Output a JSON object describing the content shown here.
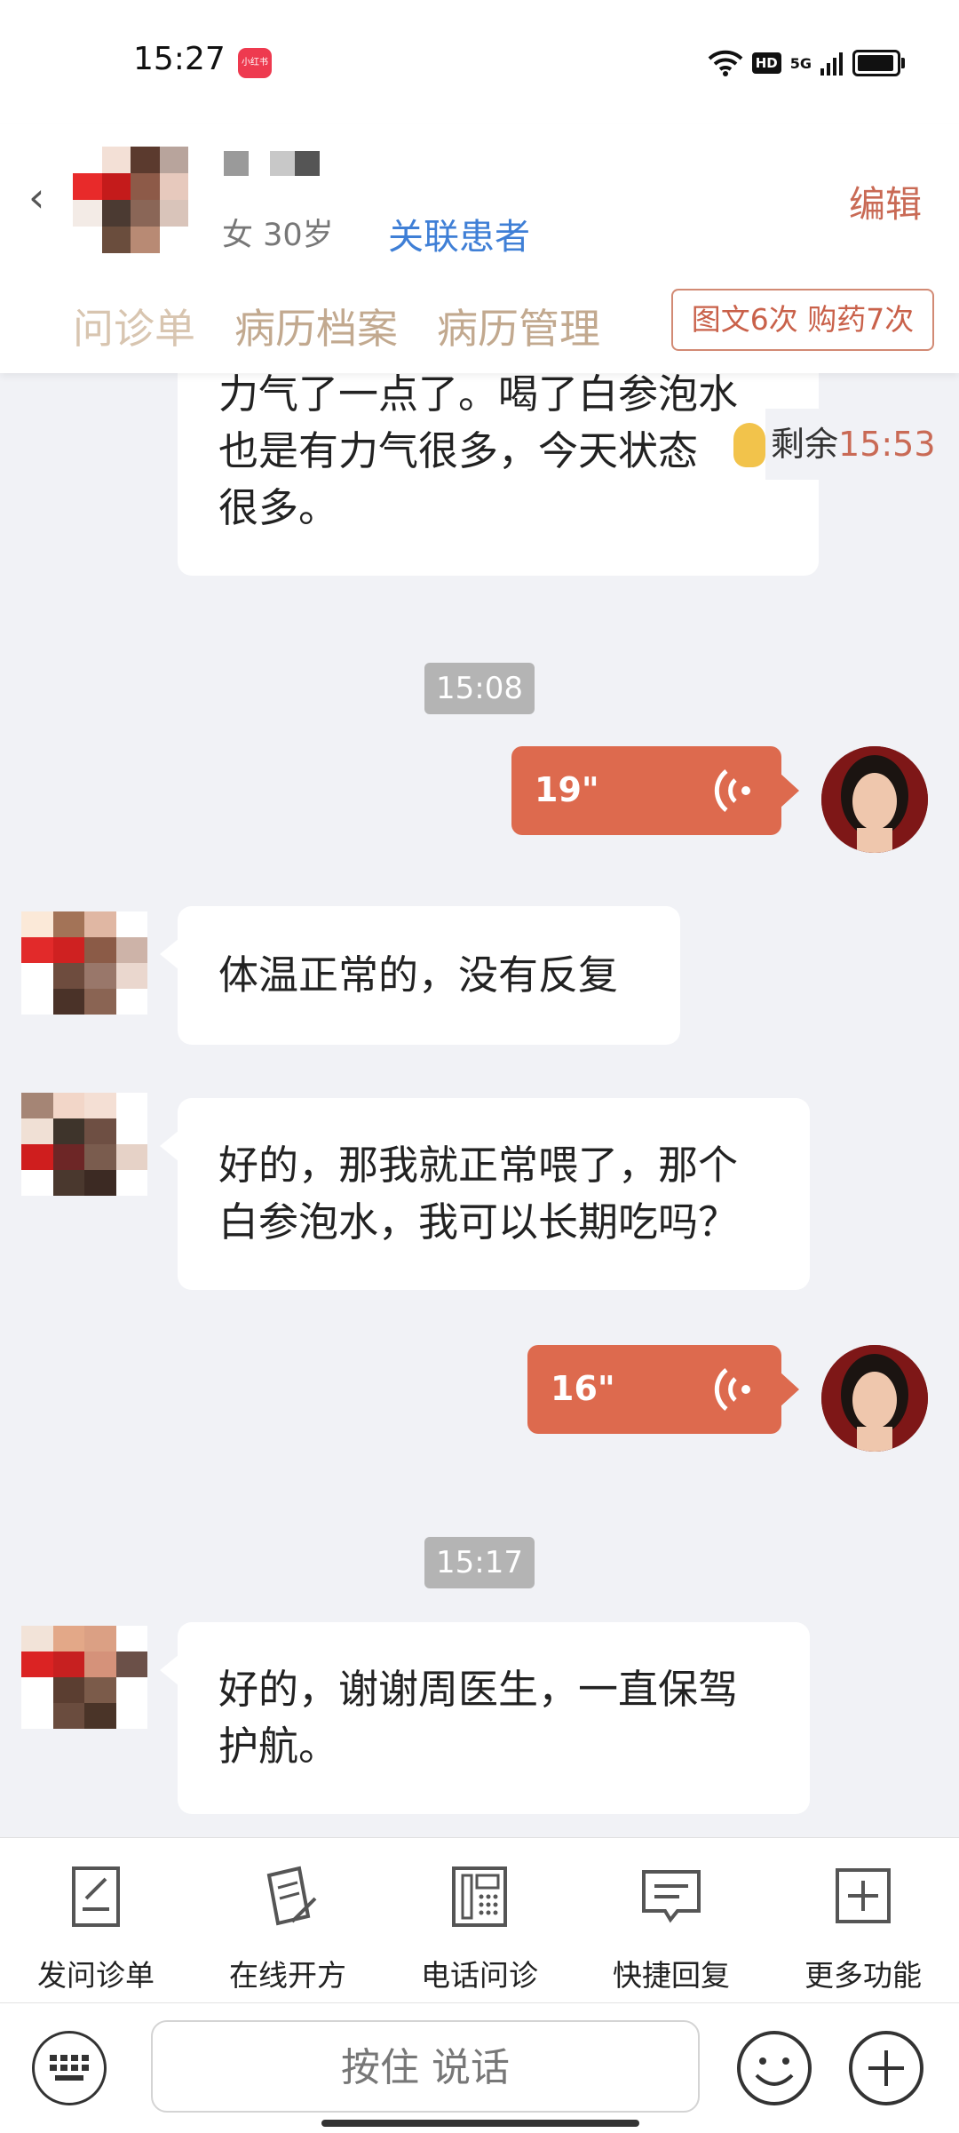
{
  "status_bar": {
    "time": "15:27",
    "app_badge": "小红书",
    "hd": "HD",
    "network": "5G"
  },
  "header": {
    "patient_info": "女 30岁",
    "link_patient": "关联患者",
    "edit": "编辑",
    "tabs": [
      "问诊单",
      "病历档案",
      "病历管理"
    ],
    "counts": "图文6次 购药7次",
    "remaining_label": "剩余",
    "remaining_time": "15:53"
  },
  "chat": {
    "msg_partial": [
      "力气了一点了。喝了白参泡水",
      "也是有力气很多，今天状态",
      "很多。"
    ],
    "time_1": "15:08",
    "voice_1": "19\"",
    "msg_2": "体温正常的，没有反复",
    "msg_3": [
      "好的，那我就正常喂了，那个",
      "白参泡水，我可以长期吃吗？"
    ],
    "voice_2": "16\"",
    "time_2": "15:17",
    "msg_4": [
      "好的，谢谢周医生，一直保驾",
      "护航。"
    ]
  },
  "toolbar": {
    "items": [
      "发问诊单",
      "在线开方",
      "电话问诊",
      "快捷回复",
      "更多功能"
    ]
  },
  "input": {
    "press_to_talk": "按住 说话"
  },
  "colors": {
    "accent": "#c96a55",
    "voice": "#dd6a4e",
    "link": "#3f7fd6"
  }
}
